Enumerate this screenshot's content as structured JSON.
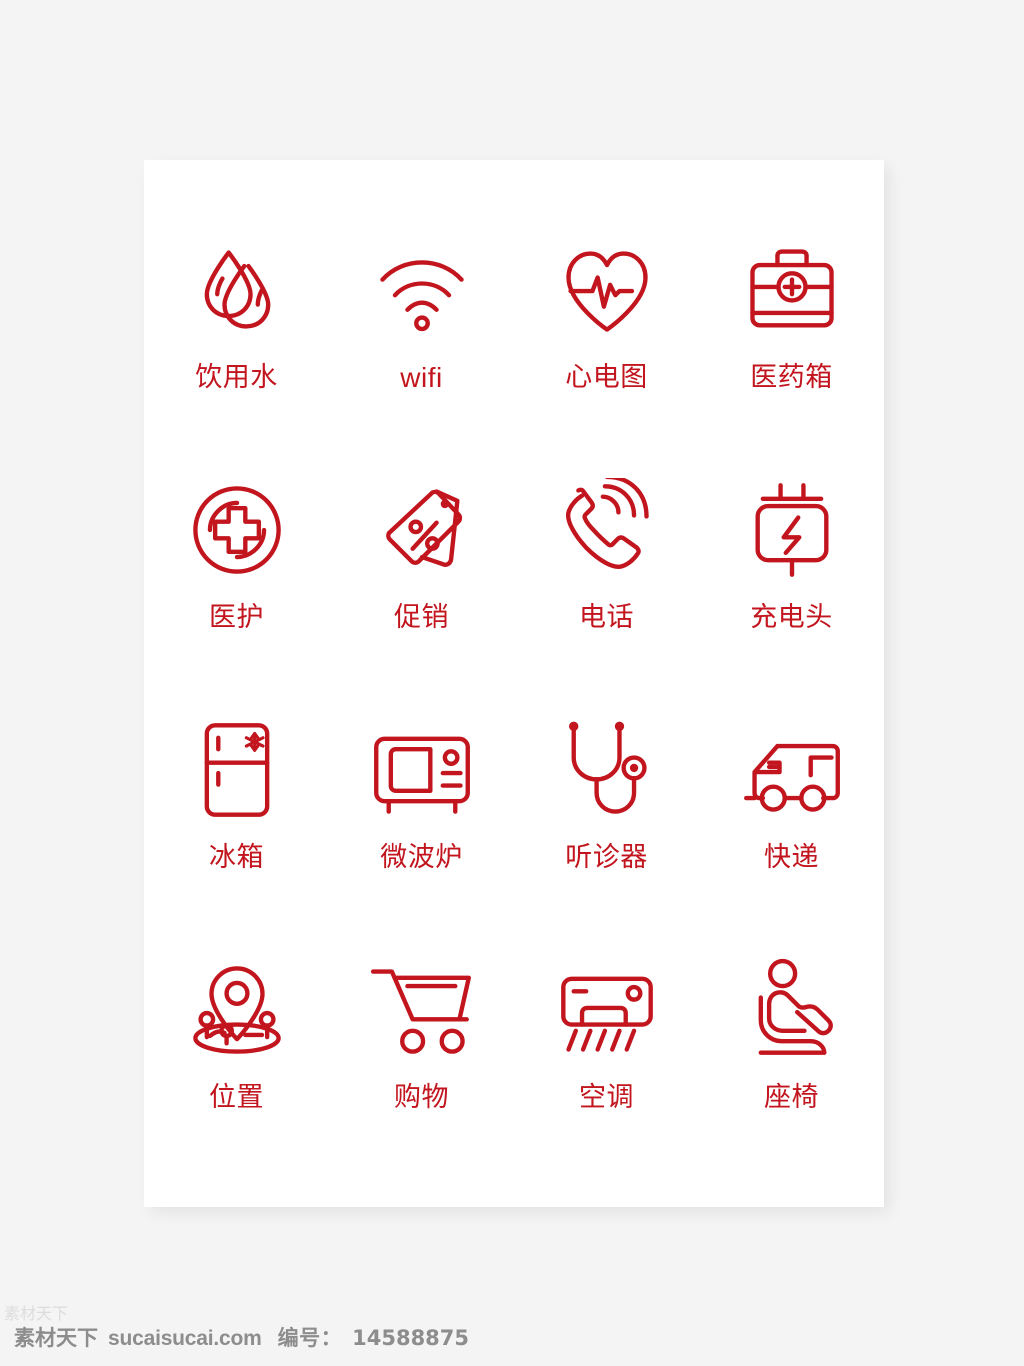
{
  "theme": {
    "page_background": "#f4f4f4",
    "card_background": "#ffffff",
    "icon_color": "#c2151e",
    "label_color": "#c2151e",
    "watermark_color": "#8d8d8d"
  },
  "card": {
    "columns": 4,
    "rows": 4
  },
  "icons": [
    {
      "id": "drinking-water",
      "icon": "water-drops-icon",
      "label": "饮用水",
      "script": "cjk"
    },
    {
      "id": "wifi",
      "icon": "wifi-icon",
      "label": "wifi",
      "script": "latin"
    },
    {
      "id": "ecg",
      "icon": "heart-pulse-icon",
      "label": "心电图",
      "script": "cjk"
    },
    {
      "id": "medical-kit",
      "icon": "first-aid-kit-icon",
      "label": "医药箱",
      "script": "cjk"
    },
    {
      "id": "medical-care",
      "icon": "medical-cross-circle-icon",
      "label": "医护",
      "script": "cjk"
    },
    {
      "id": "promotion",
      "icon": "discount-tags-icon",
      "label": "促销",
      "script": "cjk"
    },
    {
      "id": "telephone",
      "icon": "phone-ringing-icon",
      "label": "电话",
      "script": "cjk"
    },
    {
      "id": "charger",
      "icon": "power-adapter-icon",
      "label": "充电头",
      "script": "cjk"
    },
    {
      "id": "refrigerator",
      "icon": "fridge-icon",
      "label": "冰箱",
      "script": "cjk"
    },
    {
      "id": "microwave",
      "icon": "microwave-icon",
      "label": "微波炉",
      "script": "cjk"
    },
    {
      "id": "stethoscope",
      "icon": "stethoscope-icon",
      "label": "听诊器",
      "script": "cjk"
    },
    {
      "id": "express",
      "icon": "delivery-truck-icon",
      "label": "快递",
      "script": "cjk"
    },
    {
      "id": "location",
      "icon": "map-pin-icon",
      "label": "位置",
      "script": "cjk"
    },
    {
      "id": "shopping",
      "icon": "shopping-cart-icon",
      "label": "购物",
      "script": "cjk"
    },
    {
      "id": "air-conditioner",
      "icon": "air-conditioner-icon",
      "label": "空调",
      "script": "cjk"
    },
    {
      "id": "seat",
      "icon": "seat-person-icon",
      "label": "座椅",
      "script": "cjk"
    }
  ],
  "watermark": {
    "brand": "素材天下",
    "site": "sucaisucai.com",
    "id_label": "编号：",
    "id_value": "14588875",
    "side_brand": "素材天下"
  }
}
